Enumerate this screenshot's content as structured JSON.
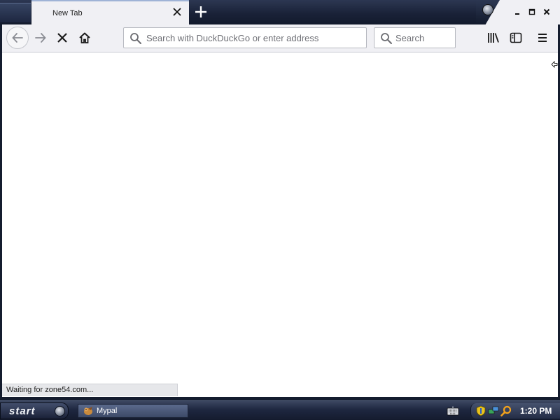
{
  "browser": {
    "tab": {
      "title": "New Tab"
    },
    "toolbar": {
      "url_placeholder": "Search with DuckDuckGo or enter address",
      "search_placeholder": "Search"
    },
    "status": "Waiting for zone54.com..."
  },
  "taskbar": {
    "start_label": "start",
    "tasks": [
      {
        "label": "Mypal"
      }
    ],
    "clock": "1:20 PM"
  },
  "icons": {
    "back": "arrow-left-icon",
    "forward": "arrow-right-icon",
    "stop": "close-x-icon",
    "home": "home-icon",
    "library": "library-icon",
    "sidebar": "sidebar-icon",
    "menu": "hamburger-menu-icon"
  },
  "colors": {
    "chrome_dark": "#1a2238",
    "toolbar_bg": "#f0f0f4",
    "content_bg": "#ffffff"
  }
}
